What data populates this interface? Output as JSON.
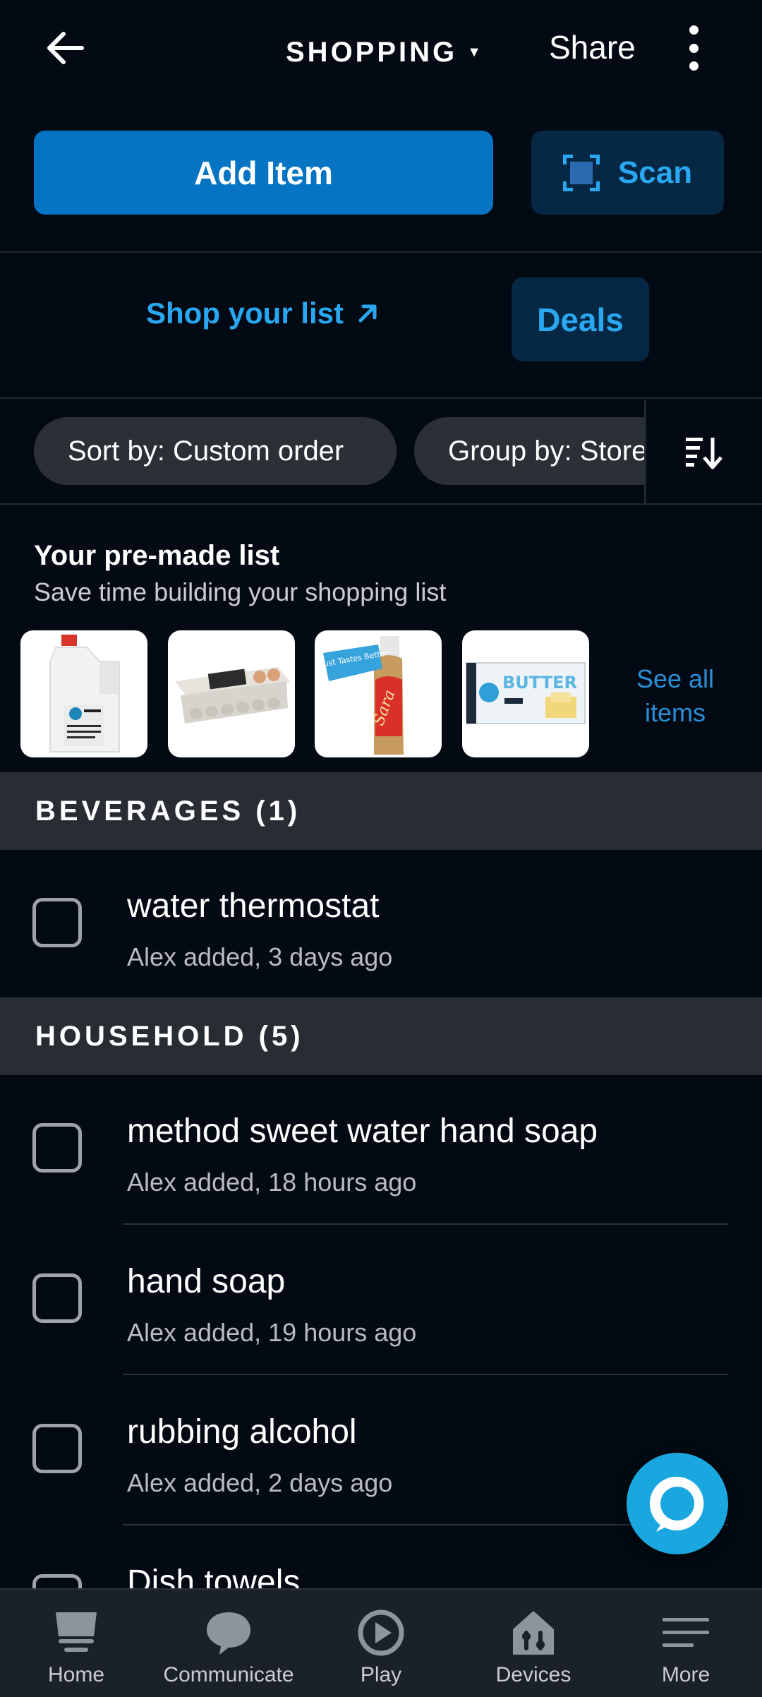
{
  "header": {
    "title": "SHOPPING",
    "share_label": "Share"
  },
  "actions": {
    "add_item_label": "Add Item",
    "scan_label": "Scan",
    "shop_link_label": "Shop your list",
    "deals_label": "Deals"
  },
  "filters": {
    "sort_label": "Sort by: Custom order",
    "group_label": "Group by: Store"
  },
  "premade": {
    "title": "Your pre-made list",
    "subtitle": "Save time building your shopping list",
    "products": [
      {
        "name": "milk",
        "image_text": ""
      },
      {
        "name": "eggs",
        "image_text": ""
      },
      {
        "name": "bread",
        "image_text": "It Just Tastes Better!"
      },
      {
        "name": "butter",
        "image_text": "BUTTER"
      }
    ],
    "see_all_label": "See all items"
  },
  "sections": [
    {
      "header": "BEVERAGES (1)",
      "items": [
        {
          "name": "water thermostat",
          "meta": "Alex added, 3 days ago"
        }
      ]
    },
    {
      "header": "HOUSEHOLD (5)",
      "items": [
        {
          "name": "method sweet water hand soap",
          "meta": "Alex added, 18 hours ago"
        },
        {
          "name": "hand soap",
          "meta": "Alex added, 19 hours ago"
        },
        {
          "name": "rubbing alcohol",
          "meta": "Alex added, 2 days ago"
        },
        {
          "name": "Dish towels",
          "meta": ""
        }
      ]
    }
  ],
  "bottom_nav": [
    {
      "label": "Home",
      "icon": "home-icon"
    },
    {
      "label": "Communicate",
      "icon": "chat-bubble-icon"
    },
    {
      "label": "Play",
      "icon": "play-icon"
    },
    {
      "label": "Devices",
      "icon": "devices-icon"
    },
    {
      "label": "More",
      "icon": "menu-icon"
    }
  ],
  "colors": {
    "background": "#030a13",
    "primary_button": "#0574c2",
    "secondary_button": "#062844",
    "link": "#2aa7f1",
    "section_header": "#282c33",
    "chip": "#2b3037",
    "alexa_fab": "#1aa7df"
  }
}
